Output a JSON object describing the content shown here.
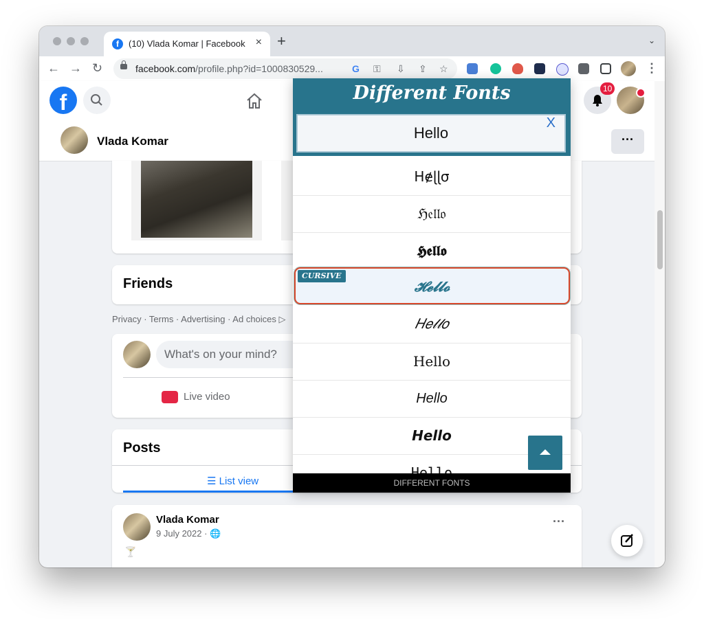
{
  "browser": {
    "tab_title": "(10) Vlada Komar | Facebook",
    "tab_close": "×",
    "new_tab": "+",
    "tab_menu": "⌄",
    "url_domain": "facebook.com",
    "url_rest": "/profile.php?id=1000830529...",
    "google_icon_label": "G"
  },
  "header": {
    "notification_count": "10",
    "logo_letter": "f"
  },
  "profile": {
    "name": "Vlada Komar",
    "more": "···"
  },
  "friends": {
    "heading": "Friends"
  },
  "footer_links": "Privacy · Terms · Advertising · Ad choices ▷",
  "composer": {
    "placeholder": "What's on your mind?",
    "live_video": "Live video"
  },
  "posts": {
    "heading": "Posts",
    "list_view": "List view",
    "post_author": "Vlada Komar",
    "post_date": "9 July 2022 ·",
    "post_more": "···",
    "post_text": "🍸"
  },
  "extension": {
    "title": "Different Fonts",
    "input_value": "Hello",
    "close": "X",
    "footer": "DIFFERENT FONTS",
    "selected_tag": "CURSIVE",
    "fonts": [
      {
        "text": "Hɇɭɭσ"
      },
      {
        "text": "ℌ𝔢𝔩𝔩𝔬"
      },
      {
        "text": "𝕳𝖊𝖑𝖑𝖔"
      },
      {
        "text": "𝓗𝓮𝓵𝓵𝓸"
      },
      {
        "text": "𝐻𝑒𝓁𝓁𝑜"
      },
      {
        "text": "Hello"
      },
      {
        "text": "Hello"
      },
      {
        "text": "Hello"
      },
      {
        "text": "Hello"
      }
    ]
  }
}
